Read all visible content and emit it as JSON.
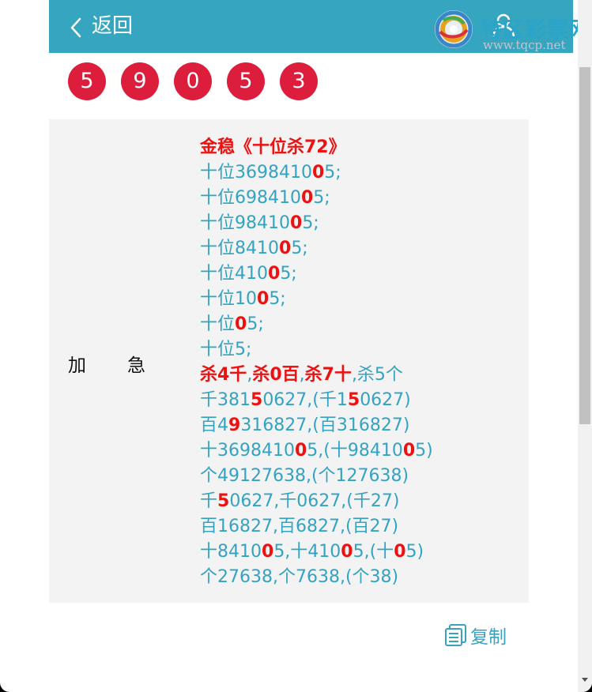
{
  "header": {
    "back_label": "返回",
    "logo_text": "特区彩票网",
    "logo_url": "www.tqcp.net"
  },
  "draw_numbers": [
    "5",
    "9",
    "0",
    "5",
    "3"
  ],
  "colors": {
    "header_bg": "#35a5c0",
    "ball": "#dc1e3c",
    "text_teal": "#33a3c4",
    "highlight_red": "#ee1111",
    "panel_bg": "#f3f3f3"
  },
  "content": {
    "type_label": "加　　急",
    "lines": [
      [
        {
          "t": "金稳《十位杀72》",
          "h": true
        }
      ],
      [
        {
          "t": "十位3698410"
        },
        {
          "t": "0",
          "h": true
        },
        {
          "t": "5;"
        }
      ],
      [
        {
          "t": "十位698410"
        },
        {
          "t": "0",
          "h": true
        },
        {
          "t": "5;"
        }
      ],
      [
        {
          "t": "十位98410"
        },
        {
          "t": "0",
          "h": true
        },
        {
          "t": "5;"
        }
      ],
      [
        {
          "t": "十位8410"
        },
        {
          "t": "0",
          "h": true
        },
        {
          "t": "5;"
        }
      ],
      [
        {
          "t": "十位410"
        },
        {
          "t": "0",
          "h": true
        },
        {
          "t": "5;"
        }
      ],
      [
        {
          "t": "十位10"
        },
        {
          "t": "0",
          "h": true
        },
        {
          "t": "5;"
        }
      ],
      [
        {
          "t": "十位"
        },
        {
          "t": "0",
          "h": true
        },
        {
          "t": "5;"
        }
      ],
      [
        {
          "t": "十位5;"
        }
      ],
      [
        {
          "t": "杀4千",
          "h": true
        },
        {
          "t": ","
        },
        {
          "t": "杀0百",
          "h": true
        },
        {
          "t": ","
        },
        {
          "t": "杀7十",
          "h": true
        },
        {
          "t": ",杀5个"
        }
      ],
      [
        {
          "t": "千381"
        },
        {
          "t": "5",
          "h": true
        },
        {
          "t": "0627,(千1"
        },
        {
          "t": "5",
          "h": true
        },
        {
          "t": "0627)"
        }
      ],
      [
        {
          "t": "百4"
        },
        {
          "t": "9",
          "h": true
        },
        {
          "t": "316827,(百316827)"
        }
      ],
      [
        {
          "t": "十3698410"
        },
        {
          "t": "0",
          "h": true
        },
        {
          "t": "5,(十98410"
        },
        {
          "t": "0",
          "h": true
        },
        {
          "t": "5)"
        }
      ],
      [
        {
          "t": "个49127638,(个127638)"
        }
      ],
      [
        {
          "t": "千"
        },
        {
          "t": "5",
          "h": true
        },
        {
          "t": "0627,千0627,(千27)"
        }
      ],
      [
        {
          "t": "百16827,百6827,(百27)"
        }
      ],
      [
        {
          "t": "十8410"
        },
        {
          "t": "0",
          "h": true
        },
        {
          "t": "5,十410"
        },
        {
          "t": "0",
          "h": true
        },
        {
          "t": "5,(十"
        },
        {
          "t": "0",
          "h": true
        },
        {
          "t": "5)"
        }
      ],
      [
        {
          "t": "个27638,个7638,(个38)"
        }
      ]
    ]
  },
  "copy_button": {
    "label": "复制"
  }
}
